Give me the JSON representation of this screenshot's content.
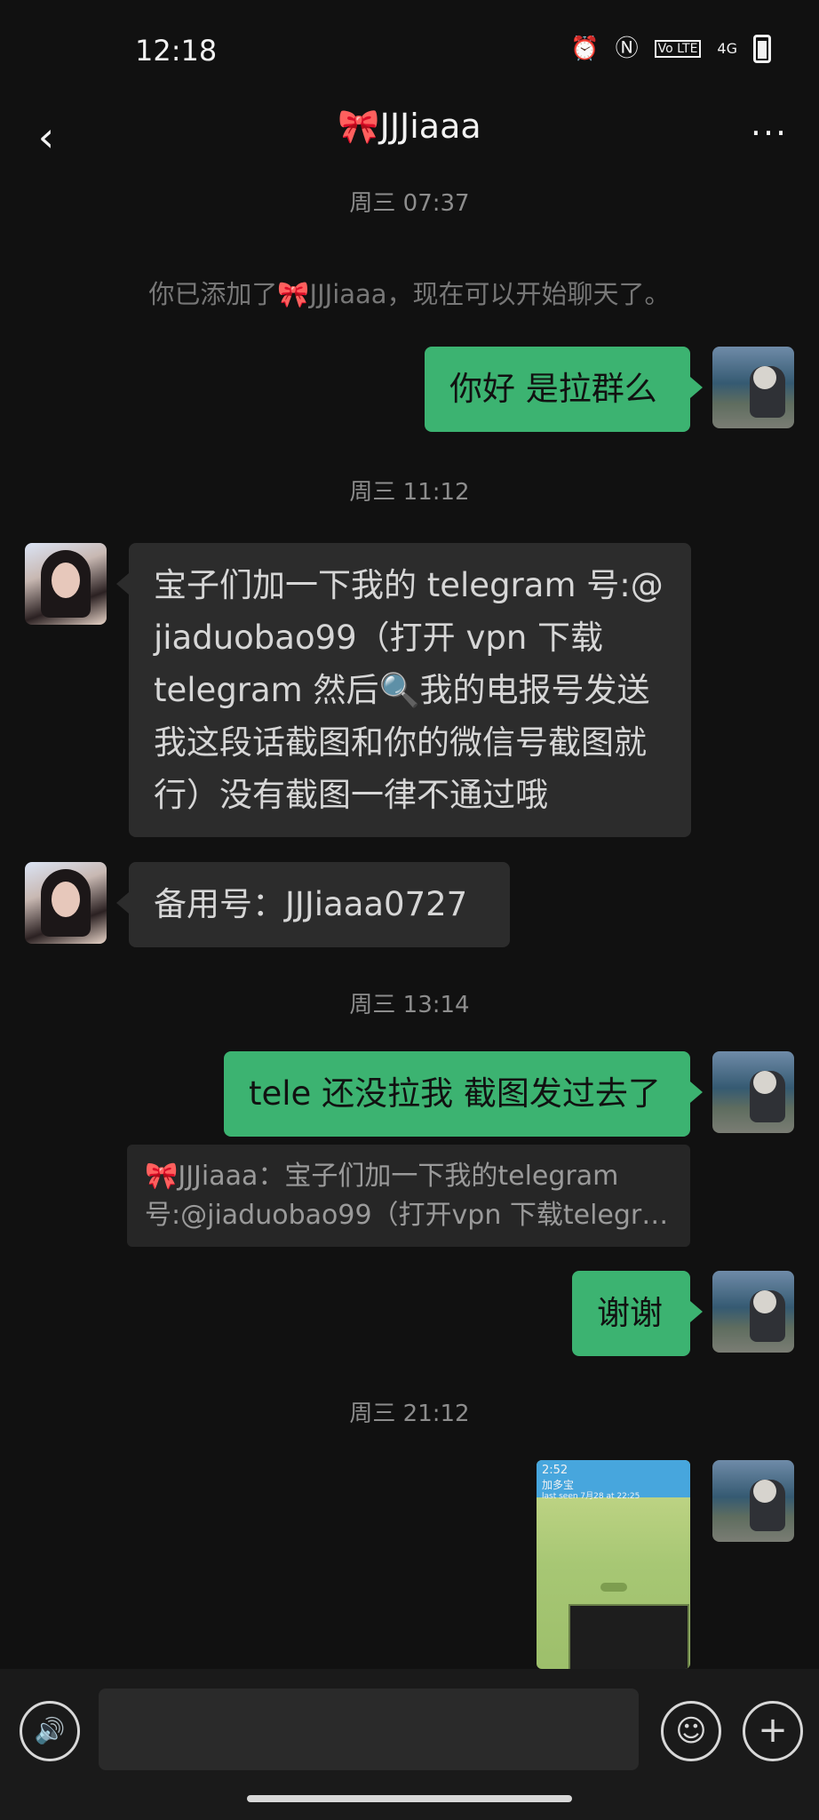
{
  "status_bar": {
    "time": "12:18",
    "icons": [
      "alarm-icon",
      "nfc-icon",
      "volte-icon",
      "4g-signal-icon",
      "battery-icon"
    ],
    "volte_label": "Vo LTE",
    "network_label": "4G"
  },
  "header": {
    "title": "🎀JJJiaaa",
    "back_icon": "chevron-left-icon",
    "more_icon": "more-dots-icon"
  },
  "messages": [
    {
      "type": "timestamp",
      "text": "周三 07:37"
    },
    {
      "type": "system",
      "text": "你已添加了🎀JJJiaaa，现在可以开始聊天了。"
    },
    {
      "type": "text",
      "sender": "me",
      "text": "你好 是拉群么"
    },
    {
      "type": "timestamp",
      "text": "周三 11:12"
    },
    {
      "type": "text",
      "sender": "other",
      "text": "宝子们加一下我的 telegram 号:@\njiaduobao99（打开 vpn 下载\ntelegram 然后🔍我的电报号发送\n我这段话截图和你的微信号截图就\n行）没有截图一律不通过哦"
    },
    {
      "type": "text",
      "sender": "other",
      "text": "备用号：JJJiaaa0727"
    },
    {
      "type": "timestamp",
      "text": "周三 13:14"
    },
    {
      "type": "text",
      "sender": "me",
      "text": "tele 还没拉我 截图发过去了"
    },
    {
      "type": "quote",
      "line1": "🎀JJJiaaa：宝子们加一下我的telegram",
      "line2": "号:@jiaduobao99（打开vpn 下载telegra..."
    },
    {
      "type": "text",
      "sender": "me",
      "text": "谢谢"
    },
    {
      "type": "timestamp",
      "text": "周三 21:12"
    },
    {
      "type": "image",
      "sender": "me",
      "caption_title": "加多宝",
      "caption_sub": "last seen 7月28 at 22:25",
      "caption_time": "2:52"
    }
  ],
  "input_bar": {
    "placeholder": "",
    "voice_icon": "voice-icon",
    "emoji_icon": "emoji-icon",
    "plus_icon": "plus-icon"
  },
  "colors": {
    "background": "#111111",
    "bubble_me": "#3cb371",
    "bubble_other": "#2c2c2c"
  }
}
